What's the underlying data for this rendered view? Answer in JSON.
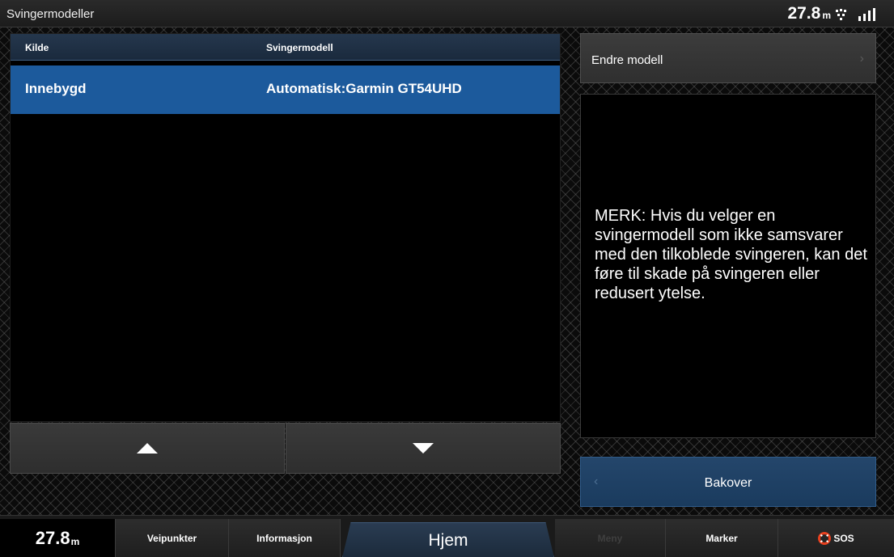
{
  "header": {
    "title": "Svingermodeller",
    "depth_value": "27.8",
    "depth_unit": "m"
  },
  "table": {
    "columns": [
      "Kilde",
      "Svingermodell"
    ],
    "rows": [
      {
        "source": "Innebygd",
        "model": "Automatisk:Garmin GT54UHD",
        "selected": true
      }
    ]
  },
  "side": {
    "change_model_label": "Endre modell",
    "note": "MERK: Hvis du velger en svingermodell som ikke samsvarer med den tilkoblede svingeren, kan det føre til skade på svingeren eller redusert ytelse.",
    "back_label": "Bakover"
  },
  "bottom_bar": {
    "depth_value": "27.8",
    "depth_unit": "m",
    "waypoints": "Veipunkter",
    "info": "Informasjon",
    "home": "Hjem",
    "menu": "Meny",
    "marker": "Marker",
    "sos": "SOS"
  },
  "colors": {
    "selected_row": "#1c5a9c",
    "back_button": "#1f4166",
    "sos_icon": "#e8401e"
  },
  "icons": {
    "scroll_up": "triangle-up-icon",
    "scroll_down": "triangle-down-icon",
    "status": "signal-icon",
    "back": "chevron-left-icon",
    "change": "chevron-right-icon",
    "sos": "lifebuoy-icon"
  }
}
